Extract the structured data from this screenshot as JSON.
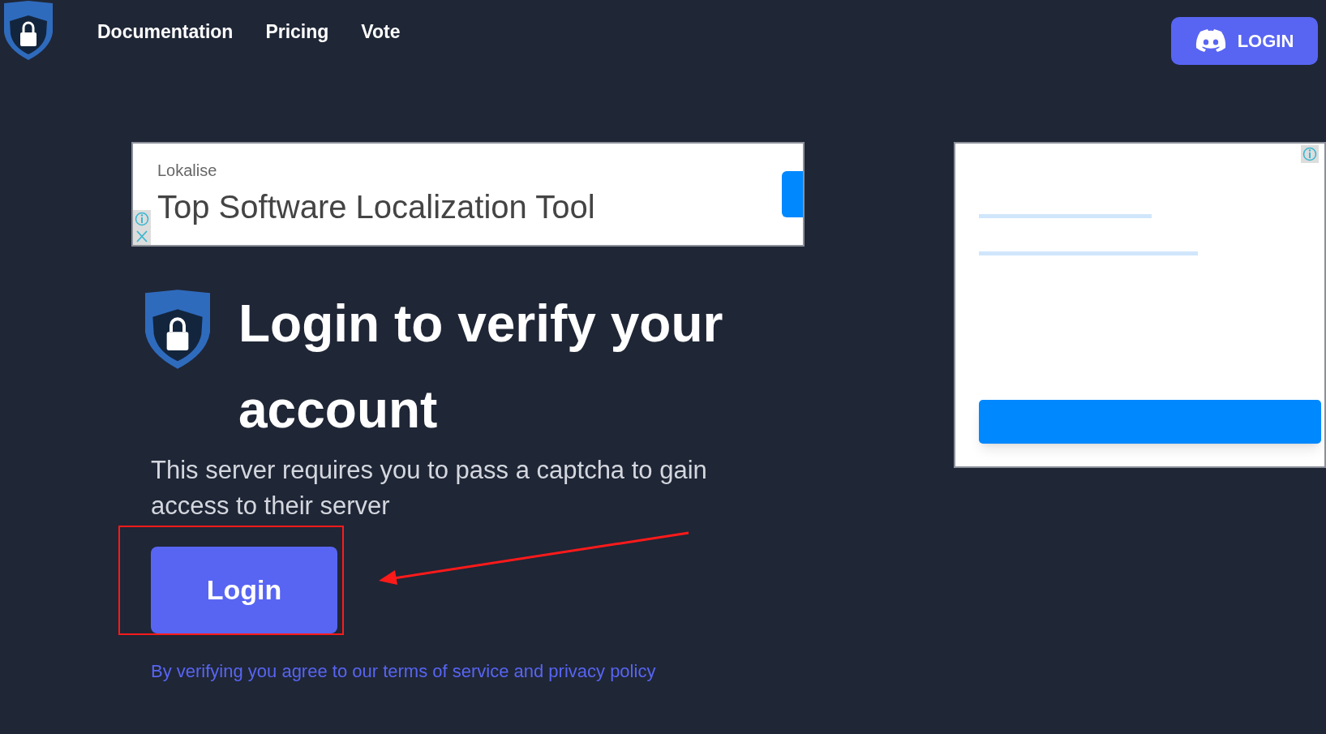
{
  "nav": {
    "links": [
      "Documentation",
      "Pricing",
      "Vote"
    ],
    "login_button": "LOGIN"
  },
  "ad_banner": {
    "advertiser": "Lokalise",
    "headline": "Top Software Localization Tool"
  },
  "main": {
    "heading": "Login to verify your account",
    "description": "This server requires you to pass a captcha to gain access to their server",
    "login_button": "Login",
    "terms": "By verifying you agree to our terms of service and privacy policy"
  }
}
